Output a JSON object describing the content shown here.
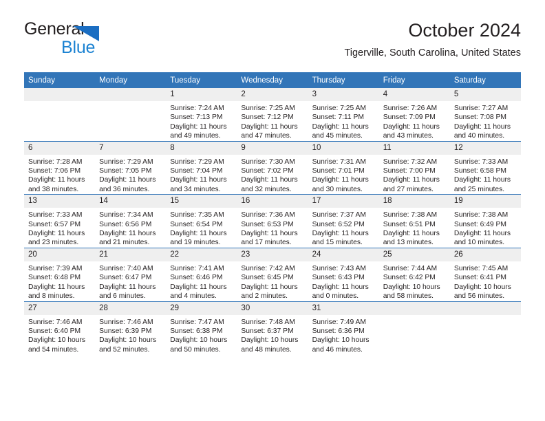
{
  "brand": {
    "word_one": "General",
    "word_two": "Blue",
    "triangle_color": "#1b6ec2",
    "text_color": "#231f20",
    "blue_text_color": "#1b82d2"
  },
  "header": {
    "title": "October 2024",
    "subtitle": "Tigerville, South Carolina, United States"
  },
  "colors": {
    "header_blue": "#3275b8",
    "row_gray": "#efefef",
    "text": "#231f20"
  },
  "calendar": {
    "weekdays": [
      "Sunday",
      "Monday",
      "Tuesday",
      "Wednesday",
      "Thursday",
      "Friday",
      "Saturday"
    ],
    "weeks": [
      [
        {
          "day": "",
          "sunrise": "",
          "sunset": "",
          "daylight_line1": "",
          "daylight_line2": ""
        },
        {
          "day": "",
          "sunrise": "",
          "sunset": "",
          "daylight_line1": "",
          "daylight_line2": ""
        },
        {
          "day": "1",
          "sunrise": "Sunrise: 7:24 AM",
          "sunset": "Sunset: 7:13 PM",
          "daylight_line1": "Daylight: 11 hours",
          "daylight_line2": "and 49 minutes."
        },
        {
          "day": "2",
          "sunrise": "Sunrise: 7:25 AM",
          "sunset": "Sunset: 7:12 PM",
          "daylight_line1": "Daylight: 11 hours",
          "daylight_line2": "and 47 minutes."
        },
        {
          "day": "3",
          "sunrise": "Sunrise: 7:25 AM",
          "sunset": "Sunset: 7:11 PM",
          "daylight_line1": "Daylight: 11 hours",
          "daylight_line2": "and 45 minutes."
        },
        {
          "day": "4",
          "sunrise": "Sunrise: 7:26 AM",
          "sunset": "Sunset: 7:09 PM",
          "daylight_line1": "Daylight: 11 hours",
          "daylight_line2": "and 43 minutes."
        },
        {
          "day": "5",
          "sunrise": "Sunrise: 7:27 AM",
          "sunset": "Sunset: 7:08 PM",
          "daylight_line1": "Daylight: 11 hours",
          "daylight_line2": "and 40 minutes."
        }
      ],
      [
        {
          "day": "6",
          "sunrise": "Sunrise: 7:28 AM",
          "sunset": "Sunset: 7:06 PM",
          "daylight_line1": "Daylight: 11 hours",
          "daylight_line2": "and 38 minutes."
        },
        {
          "day": "7",
          "sunrise": "Sunrise: 7:29 AM",
          "sunset": "Sunset: 7:05 PM",
          "daylight_line1": "Daylight: 11 hours",
          "daylight_line2": "and 36 minutes."
        },
        {
          "day": "8",
          "sunrise": "Sunrise: 7:29 AM",
          "sunset": "Sunset: 7:04 PM",
          "daylight_line1": "Daylight: 11 hours",
          "daylight_line2": "and 34 minutes."
        },
        {
          "day": "9",
          "sunrise": "Sunrise: 7:30 AM",
          "sunset": "Sunset: 7:02 PM",
          "daylight_line1": "Daylight: 11 hours",
          "daylight_line2": "and 32 minutes."
        },
        {
          "day": "10",
          "sunrise": "Sunrise: 7:31 AM",
          "sunset": "Sunset: 7:01 PM",
          "daylight_line1": "Daylight: 11 hours",
          "daylight_line2": "and 30 minutes."
        },
        {
          "day": "11",
          "sunrise": "Sunrise: 7:32 AM",
          "sunset": "Sunset: 7:00 PM",
          "daylight_line1": "Daylight: 11 hours",
          "daylight_line2": "and 27 minutes."
        },
        {
          "day": "12",
          "sunrise": "Sunrise: 7:33 AM",
          "sunset": "Sunset: 6:58 PM",
          "daylight_line1": "Daylight: 11 hours",
          "daylight_line2": "and 25 minutes."
        }
      ],
      [
        {
          "day": "13",
          "sunrise": "Sunrise: 7:33 AM",
          "sunset": "Sunset: 6:57 PM",
          "daylight_line1": "Daylight: 11 hours",
          "daylight_line2": "and 23 minutes."
        },
        {
          "day": "14",
          "sunrise": "Sunrise: 7:34 AM",
          "sunset": "Sunset: 6:56 PM",
          "daylight_line1": "Daylight: 11 hours",
          "daylight_line2": "and 21 minutes."
        },
        {
          "day": "15",
          "sunrise": "Sunrise: 7:35 AM",
          "sunset": "Sunset: 6:54 PM",
          "daylight_line1": "Daylight: 11 hours",
          "daylight_line2": "and 19 minutes."
        },
        {
          "day": "16",
          "sunrise": "Sunrise: 7:36 AM",
          "sunset": "Sunset: 6:53 PM",
          "daylight_line1": "Daylight: 11 hours",
          "daylight_line2": "and 17 minutes."
        },
        {
          "day": "17",
          "sunrise": "Sunrise: 7:37 AM",
          "sunset": "Sunset: 6:52 PM",
          "daylight_line1": "Daylight: 11 hours",
          "daylight_line2": "and 15 minutes."
        },
        {
          "day": "18",
          "sunrise": "Sunrise: 7:38 AM",
          "sunset": "Sunset: 6:51 PM",
          "daylight_line1": "Daylight: 11 hours",
          "daylight_line2": "and 13 minutes."
        },
        {
          "day": "19",
          "sunrise": "Sunrise: 7:38 AM",
          "sunset": "Sunset: 6:49 PM",
          "daylight_line1": "Daylight: 11 hours",
          "daylight_line2": "and 10 minutes."
        }
      ],
      [
        {
          "day": "20",
          "sunrise": "Sunrise: 7:39 AM",
          "sunset": "Sunset: 6:48 PM",
          "daylight_line1": "Daylight: 11 hours",
          "daylight_line2": "and 8 minutes."
        },
        {
          "day": "21",
          "sunrise": "Sunrise: 7:40 AM",
          "sunset": "Sunset: 6:47 PM",
          "daylight_line1": "Daylight: 11 hours",
          "daylight_line2": "and 6 minutes."
        },
        {
          "day": "22",
          "sunrise": "Sunrise: 7:41 AM",
          "sunset": "Sunset: 6:46 PM",
          "daylight_line1": "Daylight: 11 hours",
          "daylight_line2": "and 4 minutes."
        },
        {
          "day": "23",
          "sunrise": "Sunrise: 7:42 AM",
          "sunset": "Sunset: 6:45 PM",
          "daylight_line1": "Daylight: 11 hours",
          "daylight_line2": "and 2 minutes."
        },
        {
          "day": "24",
          "sunrise": "Sunrise: 7:43 AM",
          "sunset": "Sunset: 6:43 PM",
          "daylight_line1": "Daylight: 11 hours",
          "daylight_line2": "and 0 minutes."
        },
        {
          "day": "25",
          "sunrise": "Sunrise: 7:44 AM",
          "sunset": "Sunset: 6:42 PM",
          "daylight_line1": "Daylight: 10 hours",
          "daylight_line2": "and 58 minutes."
        },
        {
          "day": "26",
          "sunrise": "Sunrise: 7:45 AM",
          "sunset": "Sunset: 6:41 PM",
          "daylight_line1": "Daylight: 10 hours",
          "daylight_line2": "and 56 minutes."
        }
      ],
      [
        {
          "day": "27",
          "sunrise": "Sunrise: 7:46 AM",
          "sunset": "Sunset: 6:40 PM",
          "daylight_line1": "Daylight: 10 hours",
          "daylight_line2": "and 54 minutes."
        },
        {
          "day": "28",
          "sunrise": "Sunrise: 7:46 AM",
          "sunset": "Sunset: 6:39 PM",
          "daylight_line1": "Daylight: 10 hours",
          "daylight_line2": "and 52 minutes."
        },
        {
          "day": "29",
          "sunrise": "Sunrise: 7:47 AM",
          "sunset": "Sunset: 6:38 PM",
          "daylight_line1": "Daylight: 10 hours",
          "daylight_line2": "and 50 minutes."
        },
        {
          "day": "30",
          "sunrise": "Sunrise: 7:48 AM",
          "sunset": "Sunset: 6:37 PM",
          "daylight_line1": "Daylight: 10 hours",
          "daylight_line2": "and 48 minutes."
        },
        {
          "day": "31",
          "sunrise": "Sunrise: 7:49 AM",
          "sunset": "Sunset: 6:36 PM",
          "daylight_line1": "Daylight: 10 hours",
          "daylight_line2": "and 46 minutes."
        },
        {
          "day": "",
          "sunrise": "",
          "sunset": "",
          "daylight_line1": "",
          "daylight_line2": ""
        },
        {
          "day": "",
          "sunrise": "",
          "sunset": "",
          "daylight_line1": "",
          "daylight_line2": ""
        }
      ]
    ]
  }
}
